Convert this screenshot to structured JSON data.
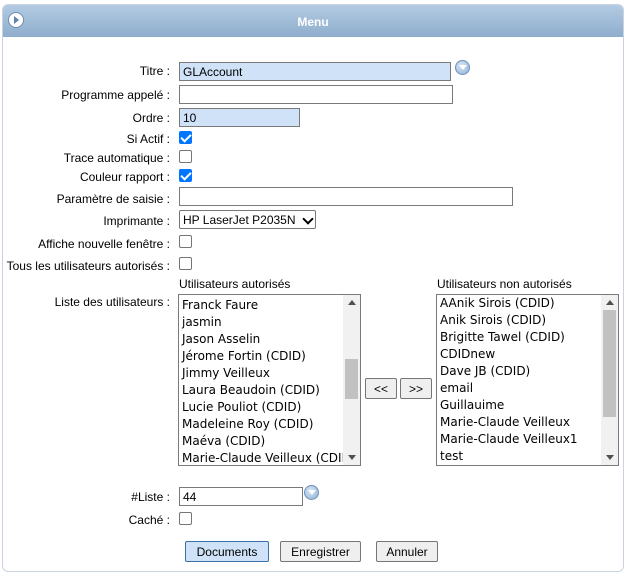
{
  "header": {
    "title": "Menu"
  },
  "form": {
    "titre_label": "Titre :",
    "titre_value": "GLAccount",
    "programme_label": "Programme appelé :",
    "programme_value": "",
    "ordre_label": "Ordre :",
    "ordre_value": "10",
    "si_actif_label": "Si Actif :",
    "si_actif_checked": true,
    "trace_label": "Trace automatique :",
    "trace_checked": false,
    "couleur_label": "Couleur rapport :",
    "couleur_checked": true,
    "parametre_label": "Paramètre de saisie :",
    "parametre_value": "",
    "imprimante_label": "Imprimante :",
    "imprimante_value": "HP LaserJet P2035N",
    "affiche_label": "Affiche nouvelle fenêtre :",
    "affiche_checked": false,
    "tous_label": "Tous les utilisateurs autorisés :",
    "tous_checked": false,
    "liste_label": "Liste des utilisateurs :",
    "liste_num_label": "#Liste :",
    "liste_num_value": "44",
    "cache_label": "Caché :",
    "cache_checked": false
  },
  "authorized": {
    "title": "Utilisateurs autorisés",
    "items": [
      "Franck Faure",
      "jasmin",
      "Jason Asselin",
      "Jérome Fortin (CDID)",
      "Jimmy Veilleux",
      "Laura Beaudoin (CDID)",
      "Lucie Pouliot (CDID)",
      "Madeleine Roy (CDID)",
      "Maéva (CDID)",
      "Marie-Claude Veilleux (CDID)"
    ]
  },
  "unauthorized": {
    "title": "Utilisateurs non autorisés",
    "items": [
      "AAnik Sirois (CDID)",
      "Anik Sirois (CDID)",
      "Brigitte Tawel (CDID)",
      "CDIDnew",
      "Dave JB (CDID)",
      "email",
      "Guillauime",
      "Marie-Claude Veilleux",
      "Marie-Claude Veilleux1",
      "test"
    ]
  },
  "transfer": {
    "left_label": "<<",
    "right_label": ">>"
  },
  "footer": {
    "documents_label": "Documents",
    "save_label": "Enregistrer",
    "cancel_label": "Annuler"
  }
}
